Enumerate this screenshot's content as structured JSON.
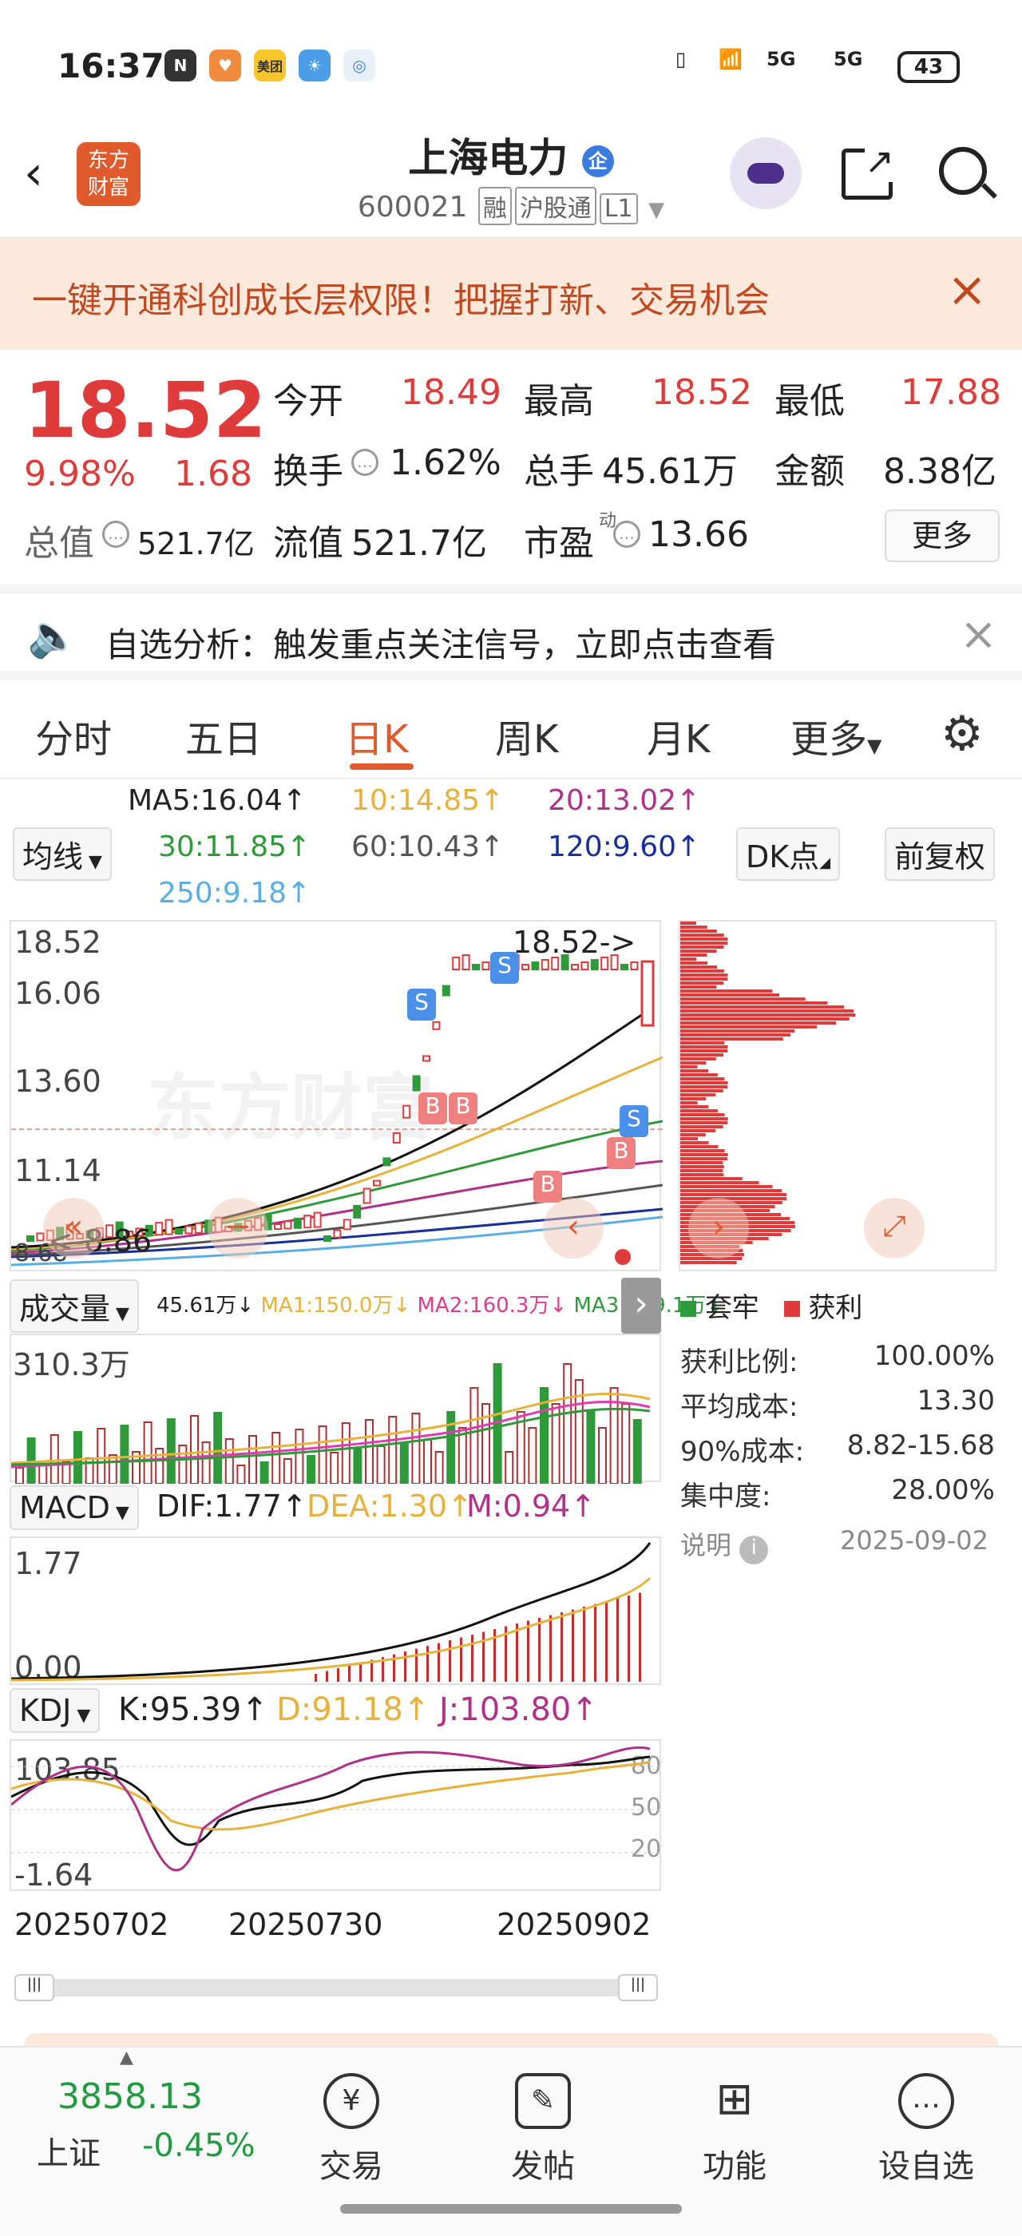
{
  "status": {
    "time": "16:37",
    "battery": "43",
    "signal1": "5G",
    "signal2": "5G",
    "icon_text": "美团"
  },
  "header": {
    "logo_line1": "东方",
    "logo_line2": "财富",
    "title": "上海电力",
    "title_badge": "企",
    "code": "600021",
    "tag1": "融",
    "tag2": "沪股通",
    "tag3": "L1"
  },
  "banner": {
    "text": "一键开通科创成长层权限！把握打新、交易机会"
  },
  "quote": {
    "price": "18.52",
    "pct": "9.98%",
    "chg": "1.68",
    "open_label": "今开",
    "open": "18.49",
    "high_label": "最高",
    "high": "18.52",
    "low_label": "最低",
    "low": "17.88",
    "turnover_label": "换手",
    "turnover": "1.62%",
    "volume_label": "总手",
    "volume": "45.61万",
    "amount_label": "金额",
    "amount": "8.38亿",
    "mcap_label": "总值",
    "mcap": "521.7亿",
    "float_label": "流值",
    "float": "521.7亿",
    "pe_label": "市盈",
    "pe_sup": "动",
    "pe": "13.66",
    "more": "更多"
  },
  "alert": {
    "text": "自选分析：触发重点关注信号，立即点击查看"
  },
  "tabs": [
    "分时",
    "五日",
    "日K",
    "周K",
    "月K",
    "更多"
  ],
  "ma": {
    "ma5": "MA5:16.04↑",
    "ma10": "10:14.85↑",
    "ma20": "20:13.02↑",
    "ma30": "30:11.85↑",
    "ma60": "60:10.43↑",
    "ma120": "120:9.60↑",
    "ma250": "250:9.18↑",
    "selector": "均线",
    "dk": "DK点",
    "adj": "前复权"
  },
  "kchart": {
    "y_labels": [
      "18.52",
      "16.06",
      "13.60",
      "11.14",
      "8.68"
    ],
    "last_label": "18.52->",
    "low_label": "<-8.86",
    "sell_marks": [
      "S",
      "S",
      "S"
    ],
    "buy_marks": [
      "B",
      "B",
      "B",
      "B"
    ],
    "watermark": "东方财富"
  },
  "volume": {
    "selector": "成交量",
    "values_text": [
      "45.61万↓",
      "MA1:150.0万↓",
      "MA2:160.3万↓",
      "MA3:149.1万↓"
    ],
    "max_label": "310.3万"
  },
  "macd": {
    "selector": "MACD",
    "dif": "DIF:1.77↑",
    "dea": "DEA:1.30↑",
    "m": "M:0.94↑",
    "max_label": "1.77",
    "zero_label": "0.00"
  },
  "kdj": {
    "selector": "KDJ",
    "k": "K:95.39↑",
    "d": "D:91.18↑",
    "j": "J:103.80↑",
    "max_label": "103.85",
    "min_label": "-1.64",
    "levels": [
      "80",
      "50",
      "20"
    ]
  },
  "dates": [
    "20250702",
    "20250730",
    "20250902"
  ],
  "chip": {
    "legend_trapped": "套牢",
    "legend_profit": "获利",
    "rows": [
      {
        "label": "获利比例:",
        "value": "100.00%"
      },
      {
        "label": "平均成本:",
        "value": "13.30"
      },
      {
        "label": "90%成本:",
        "value": "8.82-15.68"
      },
      {
        "label": "集中度:",
        "value": "28.00%"
      }
    ],
    "note": "说明",
    "date": "2025-09-02"
  },
  "bottom": {
    "index_value": "3858.13",
    "index_name": "上证",
    "index_chg": "-0.45%",
    "items": [
      "交易",
      "发帖",
      "功能",
      "设自选"
    ]
  }
}
